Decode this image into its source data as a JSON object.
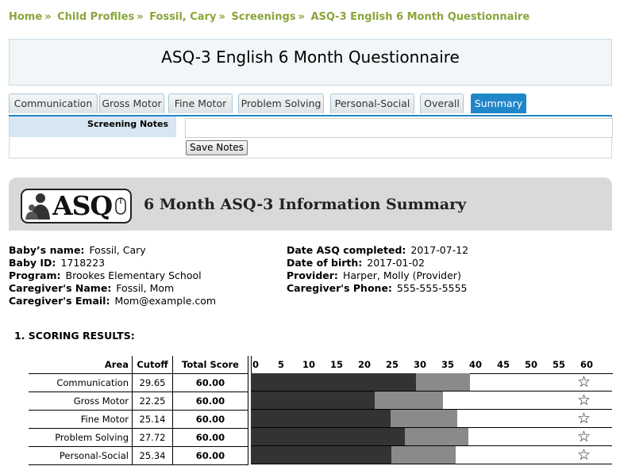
{
  "breadcrumb": [
    "Home",
    "Child Profiles",
    "Fossil, Cary",
    "Screenings",
    "ASQ-3 English 6 Month Questionnaire"
  ],
  "breadcrumb_sep": "»",
  "page_title": "ASQ-3 English 6 Month Questionnaire",
  "tabs": [
    "Communication",
    "Gross Motor",
    "Fine Motor",
    "Problem Solving",
    "Personal-Social",
    "Overall",
    "Summary"
  ],
  "active_tab": "Summary",
  "notes": {
    "label": "Screening Notes",
    "value": "",
    "save_label": "Save Notes"
  },
  "summary": {
    "logo_text": "ASQ",
    "title": "6 Month ASQ-3 Information Summary"
  },
  "info_left": [
    {
      "label": "Baby’s name:",
      "value": "Fossil, Cary"
    },
    {
      "label": "Baby ID:",
      "value": "1718223"
    },
    {
      "label": "Program:",
      "value": "Brookes Elementary School"
    },
    {
      "label": "Caregiver's Name:",
      "value": "Fossil, Mom"
    },
    {
      "label": "Caregiver's Email:",
      "value": "Mom@example.com"
    }
  ],
  "info_right": [
    {
      "label": "Date ASQ completed:",
      "value": "2017-07-12"
    },
    {
      "label": "Date of birth:",
      "value": "2017-01-02"
    },
    {
      "label": "Provider:",
      "value": "Harper, Molly (Provider)"
    },
    {
      "label": "Caregiver's Phone:",
      "value": "555-555-5555"
    }
  ],
  "section_title": "1. SCORING RESULTS:",
  "table_headers": {
    "area": "Area",
    "cutoff": "Cutoff",
    "total": "Total Score"
  },
  "colors": {
    "breadcrumb": "#8aa53a",
    "tab_active": "#1f86c8",
    "below_cutoff": "#333333",
    "monitoring": "#8a8a8a"
  },
  "chart_data": {
    "type": "bar",
    "x_ticks": [
      0,
      5,
      10,
      15,
      20,
      25,
      30,
      35,
      40,
      45,
      50,
      55,
      60
    ],
    "xlim": [
      0,
      60
    ],
    "rows": [
      {
        "area": "Communication",
        "cutoff": "29.65",
        "total": "60.00",
        "cutoff_value": 29.65,
        "monitor_value": 39.4,
        "icon": "star-icon"
      },
      {
        "area": "Gross Motor",
        "cutoff": "22.25",
        "total": "60.00",
        "cutoff_value": 22.25,
        "monitor_value": 34.6,
        "icon": "star-icon"
      },
      {
        "area": "Fine Motor",
        "cutoff": "25.14",
        "total": "60.00",
        "cutoff_value": 25.14,
        "monitor_value": 37.1,
        "icon": "star-icon"
      },
      {
        "area": "Problem Solving",
        "cutoff": "27.72",
        "total": "60.00",
        "cutoff_value": 27.72,
        "monitor_value": 39.2,
        "icon": "star-icon"
      },
      {
        "area": "Personal-Social",
        "cutoff": "25.34",
        "total": "60.00",
        "cutoff_value": 25.34,
        "monitor_value": 36.9,
        "icon": "star-icon"
      }
    ]
  }
}
